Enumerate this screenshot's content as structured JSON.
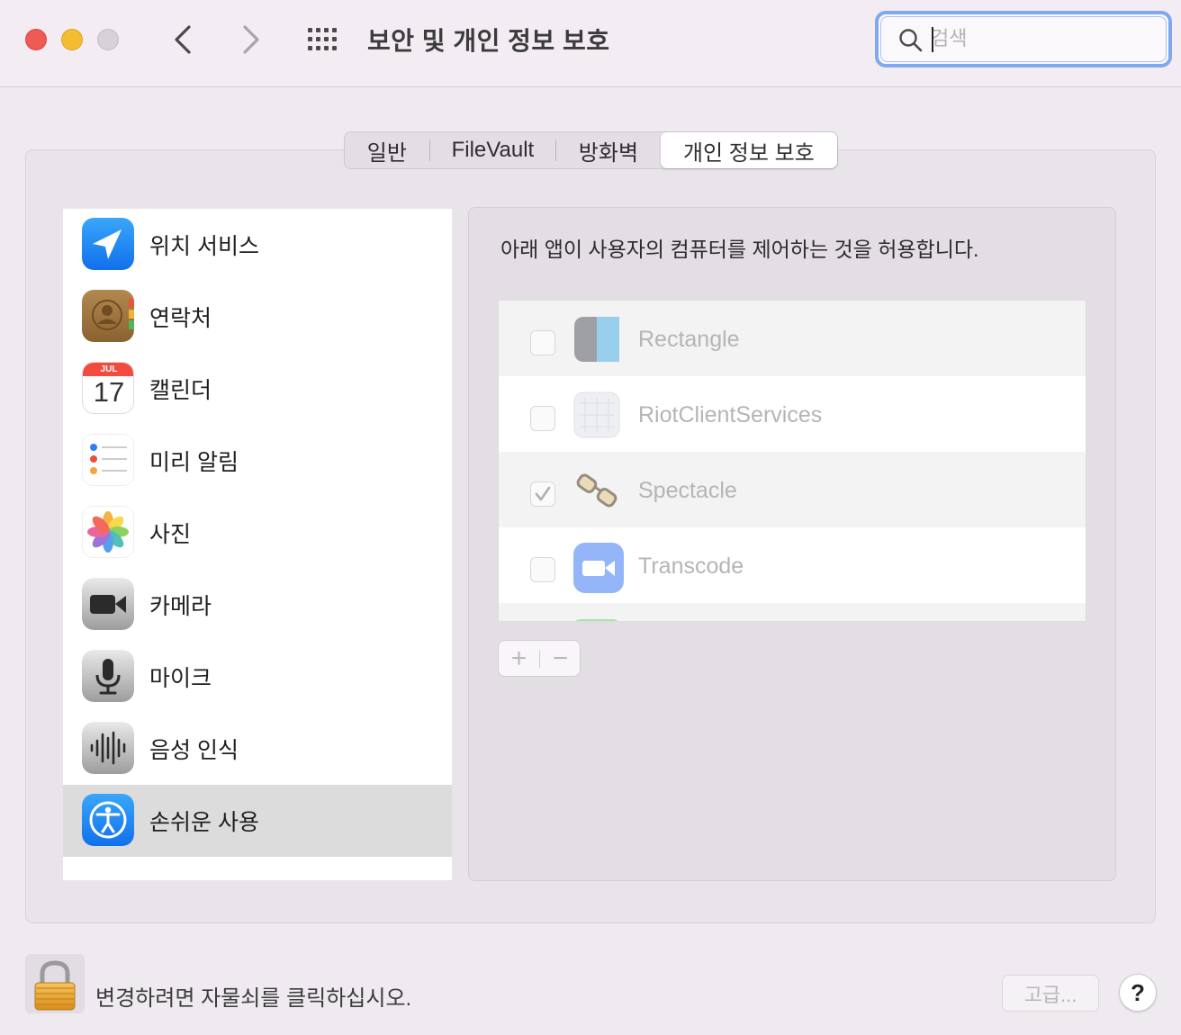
{
  "window": {
    "title": "보안 및 개인 정보 보호",
    "search_placeholder": "검색"
  },
  "tabs": [
    {
      "label": "일반"
    },
    {
      "label": "FileVault"
    },
    {
      "label": "방화벽"
    },
    {
      "label": "개인 정보 보호",
      "selected": true
    }
  ],
  "sidebar": {
    "items": [
      {
        "label": "위치 서비스",
        "icon": "location-arrow-icon"
      },
      {
        "label": "연락처",
        "icon": "contacts-icon"
      },
      {
        "label": "캘린더",
        "icon": "calendar-icon",
        "calendar_month": "JUL",
        "calendar_day": "17"
      },
      {
        "label": "미리 알림",
        "icon": "reminders-icon"
      },
      {
        "label": "사진",
        "icon": "photos-icon"
      },
      {
        "label": "카메라",
        "icon": "camera-icon"
      },
      {
        "label": "마이크",
        "icon": "microphone-icon"
      },
      {
        "label": "음성 인식",
        "icon": "speech-recognition-icon"
      },
      {
        "label": "손쉬운 사용",
        "icon": "accessibility-icon",
        "selected": true
      }
    ]
  },
  "main": {
    "description": "아래 앱이 사용자의 컴퓨터를 제어하는 것을 허용합니다.",
    "apps": [
      {
        "name": "Rectangle",
        "checked": false,
        "icon": "rectangle-app-icon"
      },
      {
        "name": "RiotClientServices",
        "checked": false,
        "icon": "riot-client-icon"
      },
      {
        "name": "Spectacle",
        "checked": true,
        "icon": "spectacle-glasses-icon"
      },
      {
        "name": "Transcode",
        "checked": false,
        "icon": "video-camera-icon"
      }
    ],
    "add_label": "+",
    "remove_label": "−"
  },
  "footer": {
    "lock_text": "변경하려면 자물쇠를 클릭하십시오.",
    "advanced_label": "고급...",
    "help_label": "?"
  },
  "colors": {
    "search_focus": "#7fa9ee",
    "selected_row": "#dcdcdc",
    "close": "#ee5b55",
    "minimize": "#f4bc2f"
  }
}
